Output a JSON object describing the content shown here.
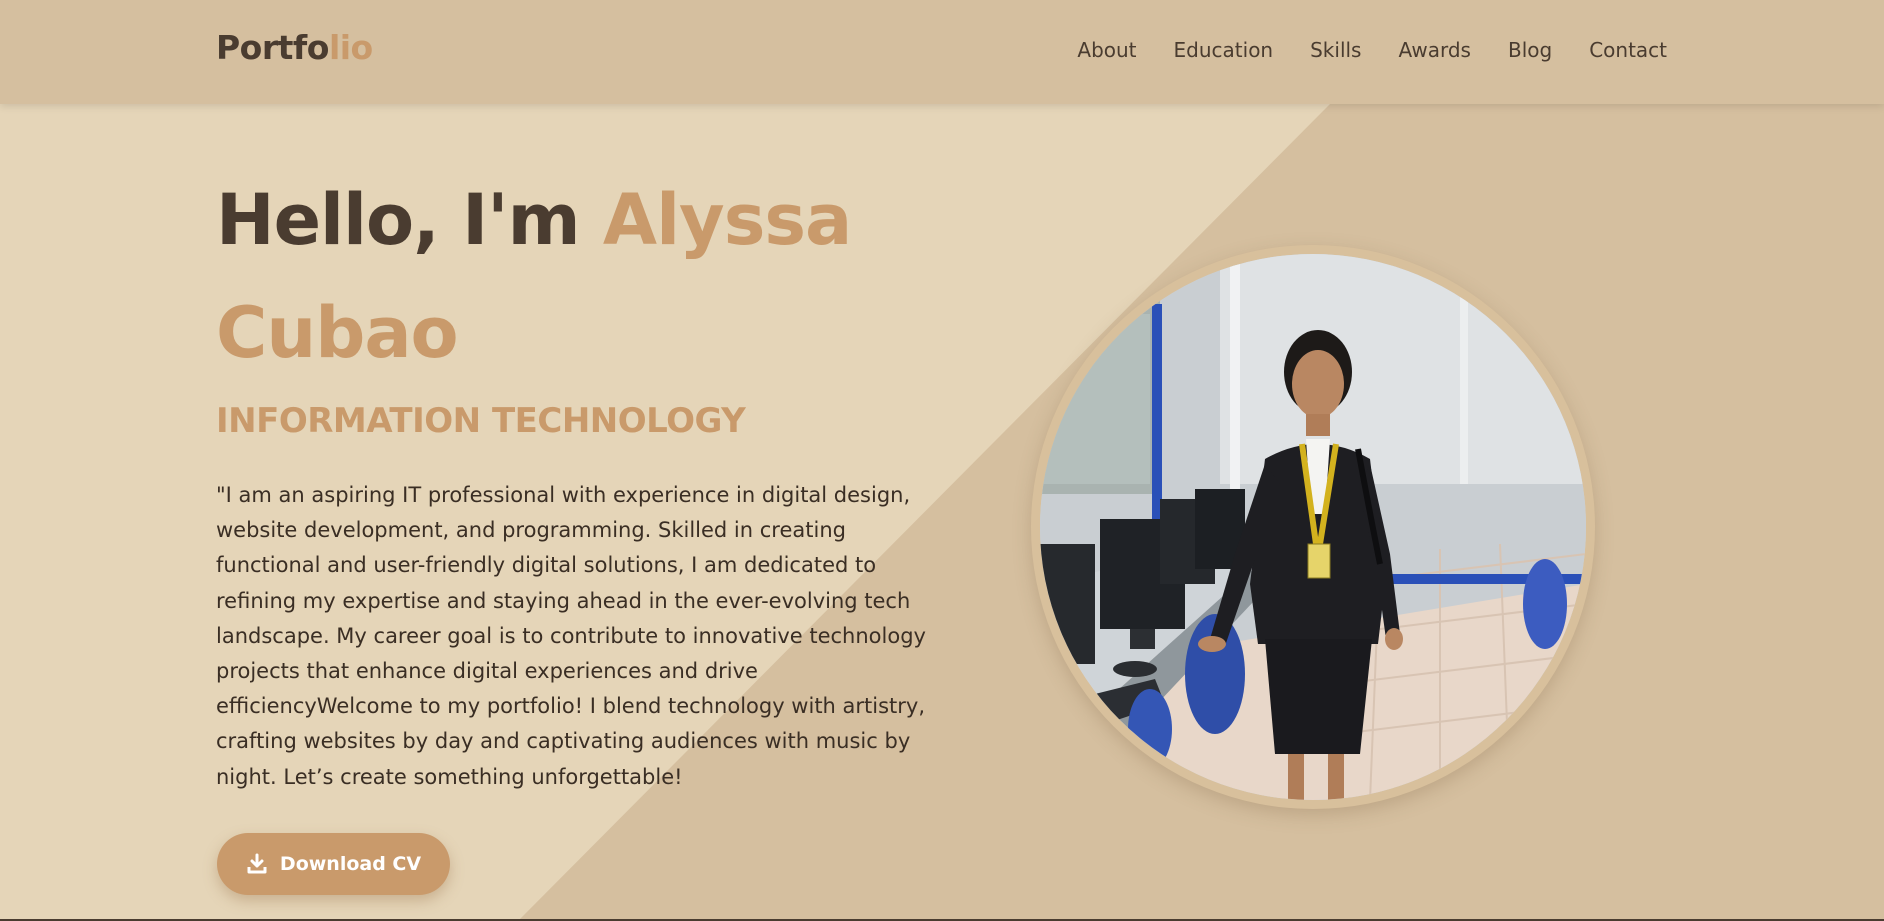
{
  "colors": {
    "nav_bg": "#d5bf9f",
    "hero_left": "#e5d5b8",
    "hero_right": "#d5bf9f",
    "accent": "#c99a6b",
    "text_dark": "#4a3c30"
  },
  "logo": {
    "part1": "Portfo",
    "part2": "lio"
  },
  "nav": {
    "items": [
      {
        "label": "About"
      },
      {
        "label": "Education"
      },
      {
        "label": "Skills"
      },
      {
        "label": "Awards"
      },
      {
        "label": "Blog"
      },
      {
        "label": "Contact"
      }
    ]
  },
  "hero": {
    "greeting": "Hello, I'm ",
    "name_first": "Alyssa",
    "name_last": "Cubao",
    "subtitle": "INFORMATION TECHNOLOGY",
    "bio": "\"I am an aspiring IT professional with experience in digital design, website development, and programming. Skilled in creating functional and user-friendly digital solutions, I am dedicated to refining my expertise and staying ahead in the ever-evolving tech landscape. My career goal is to contribute to innovative technology projects that enhance digital experiences and drive efficiencyWelcome to my portfolio! I blend technology with artistry, crafting websites by day and captivating audiences with music by night. Let’s create something unforgettable!",
    "cv_button": {
      "label": "Download CV",
      "icon": "download-icon"
    }
  },
  "profile_photo": {
    "alt": "profile-photo"
  }
}
